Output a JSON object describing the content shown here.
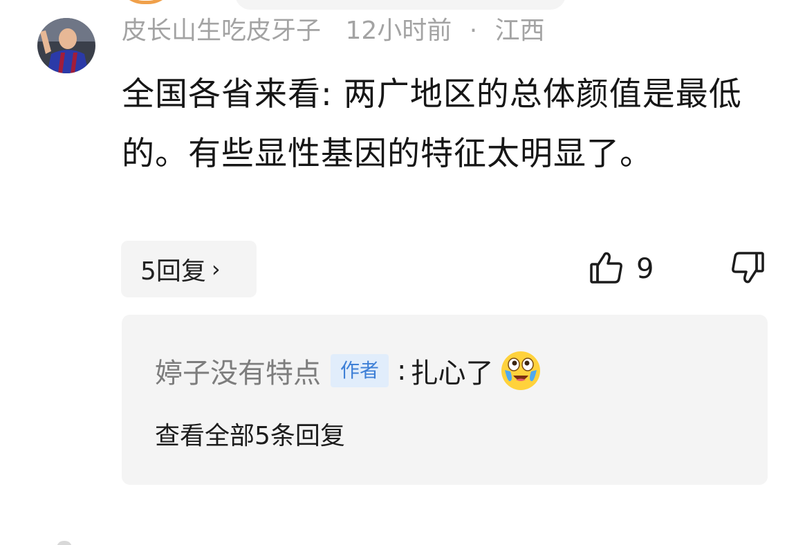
{
  "comment": {
    "username": "皮长山生吃皮牙子",
    "time": "12小时前",
    "separator": "·",
    "location": "江西",
    "text": "全国各省来看: 两广地区的总体颜值是最低的。有些显性基因的特征太明显了。",
    "replies_label": "5回复",
    "replies_chevron": "›",
    "like_count": "9",
    "icons": {
      "like": "thumbs-up-icon",
      "dislike": "thumbs-down-icon",
      "avatar": "avatar"
    }
  },
  "reply_preview": {
    "author": "婷子没有特点",
    "author_badge": "作者",
    "colon": ":",
    "text": "扎心了",
    "emoji": "crying-laughing-emoji-icon",
    "view_all": "查看全部5条回复"
  },
  "colors": {
    "meta_gray": "#a3a3a3",
    "badge_bg": "#e1edfb",
    "badge_text": "#3d7fd6",
    "panel_bg": "#f4f4f4"
  }
}
